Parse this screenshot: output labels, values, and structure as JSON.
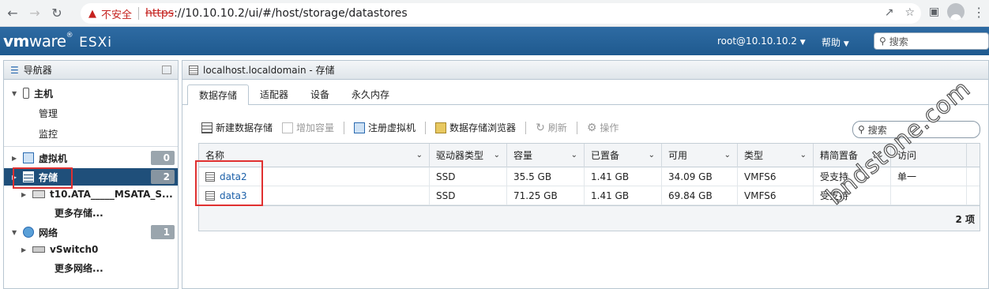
{
  "browser": {
    "insecure_label": "不安全",
    "url_scheme": "https",
    "url_rest": "://10.10.10.2/ui/#/host/storage/datastores"
  },
  "header": {
    "logo_vm": "vm",
    "logo_ware": "ware",
    "logo_product": "ESXi",
    "user": "root@10.10.10.2",
    "help": "帮助",
    "search_placeholder": "搜索"
  },
  "navigator": {
    "title": "导航器",
    "host": {
      "label": "主机",
      "children": [
        "管理",
        "监控"
      ]
    },
    "vms": {
      "label": "虚拟机",
      "count": "0"
    },
    "storage": {
      "label": "存储",
      "count": "2",
      "device": "t10.ATA_____MSATA_S...",
      "more": "更多存储..."
    },
    "network": {
      "label": "网络",
      "count": "1",
      "switch": "vSwitch0",
      "more": "更多网络..."
    }
  },
  "main": {
    "title": "localhost.localdomain - 存储",
    "tabs": [
      "数据存储",
      "适配器",
      "设备",
      "永久内存"
    ],
    "toolbar": {
      "new_datastore": "新建数据存储",
      "increase_capacity": "增加容量",
      "register_vm": "注册虚拟机",
      "datastore_browser": "数据存储浏览器",
      "refresh": "刷新",
      "actions": "操作"
    },
    "search_placeholder": "搜索",
    "columns": [
      "名称",
      "驱动器类型",
      "容量",
      "已置备",
      "可用",
      "类型",
      "精简置备",
      "访问"
    ],
    "rows": [
      [
        "data2",
        "SSD",
        "35.5 GB",
        "1.41 GB",
        "34.09 GB",
        "VMFS6",
        "受支持",
        "单一"
      ],
      [
        "data3",
        "SSD",
        "71.25 GB",
        "1.41 GB",
        "69.84 GB",
        "VMFS6",
        "受支持",
        ""
      ]
    ],
    "footer_count": "2 项"
  },
  "watermark": "bndstone.com",
  "colors": {
    "header_blue": "#2e6ba3",
    "selected_nav": "#1f4f7a",
    "highlight_red": "#e03030"
  }
}
